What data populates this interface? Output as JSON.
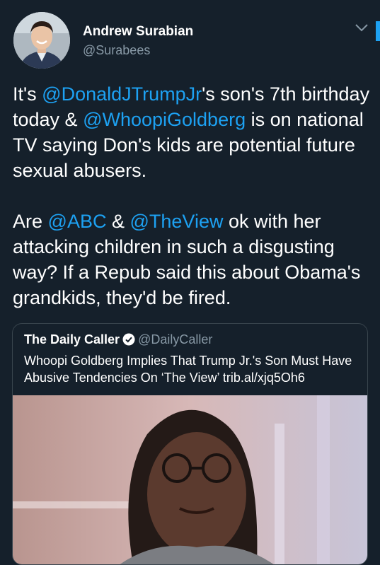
{
  "user": {
    "display_name": "Andrew Surabian",
    "handle": "@Surabees"
  },
  "tweet": {
    "p1": {
      "t1": "It's ",
      "m1": "@DonaldJTrumpJr",
      "t2": "'s son's 7th birthday today & ",
      "m2": "@WhoopiGoldberg",
      "t3": " is on national TV saying Don's kids are potential future sexual abusers."
    },
    "p2": {
      "t1": "Are ",
      "m1": "@ABC",
      "t2": " & ",
      "m2": "@TheView",
      "t3": " ok with her attacking children in such a disgusting way? If a Repub said this about Obama's grandkids, they'd be fired."
    }
  },
  "quote": {
    "name": "The Daily Caller",
    "handle": "@DailyCaller",
    "text": "Whoopi Goldberg Implies That Trump Jr.'s Son Must Have Abusive Tendencies On ‘The View’ trib.al/xjq5Oh6"
  },
  "icons": {
    "menu": "chevron-down-icon",
    "verified": "verified-badge-icon"
  },
  "colors": {
    "background": "#15202b",
    "link": "#1da1f2",
    "secondary_text": "#8899a6",
    "border": "#38444d"
  }
}
